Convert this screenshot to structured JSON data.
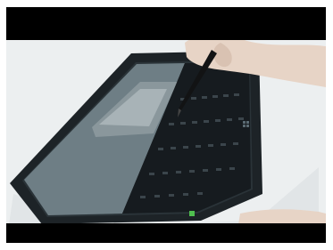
{
  "video": {
    "description_visible_text": ""
  },
  "colors": {
    "letterbox": "#000000",
    "table": "#e9ecee",
    "tablet_bezel": "#1e2326",
    "screen": "#2b3438",
    "app_panel": "#6f7f86",
    "keyboard": "#151a1e",
    "stylus": "#121314",
    "skin": "#e8d6c8"
  },
  "icons": {
    "stylus": "stylus-icon",
    "hand": "hand-icon",
    "windows": "windows-logo-icon"
  }
}
